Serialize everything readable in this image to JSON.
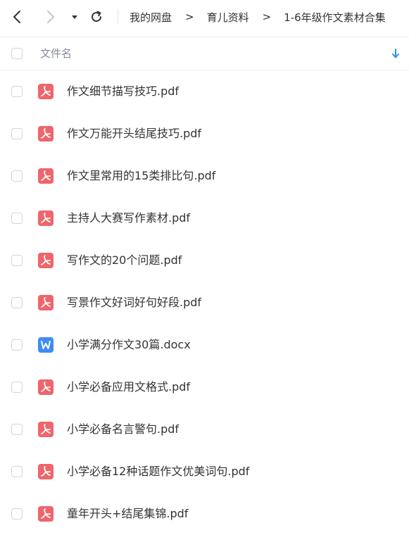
{
  "nav": {
    "back_icon": "chevron-left-icon",
    "forward_icon": "chevron-right-icon",
    "dropdown_icon": "triangle-down-icon",
    "refresh_icon": "refresh-icon"
  },
  "breadcrumb": {
    "items": [
      "我的网盘",
      "育儿资料",
      "1-6年级作文素材合集"
    ],
    "separator": ">"
  },
  "list_header": {
    "name_label": "文件名",
    "sort_icon": "arrow-down-icon"
  },
  "colors": {
    "pdf_icon": "#f0656b",
    "docx_icon": "#3f8cf5",
    "sort_icon": "#2e90f0",
    "text": "#333333",
    "header_text": "#878c9c"
  },
  "files": [
    {
      "name": "作文细节描写技巧.pdf",
      "type": "pdf",
      "icon": "pdf-icon"
    },
    {
      "name": "作文万能开头结尾技巧.pdf",
      "type": "pdf",
      "icon": "pdf-icon"
    },
    {
      "name": "作文里常用的15类排比句.pdf",
      "type": "pdf",
      "icon": "pdf-icon"
    },
    {
      "name": "主持人大赛写作素材.pdf",
      "type": "pdf",
      "icon": "pdf-icon"
    },
    {
      "name": "写作文的20个问题.pdf",
      "type": "pdf",
      "icon": "pdf-icon"
    },
    {
      "name": "写景作文好词好句好段.pdf",
      "type": "pdf",
      "icon": "pdf-icon"
    },
    {
      "name": "小学满分作文30篇.docx",
      "type": "docx",
      "icon": "word-icon"
    },
    {
      "name": "小学必备应用文格式.pdf",
      "type": "pdf",
      "icon": "pdf-icon"
    },
    {
      "name": "小学必备名言警句.pdf",
      "type": "pdf",
      "icon": "pdf-icon"
    },
    {
      "name": "小学必备12种话题作文优美词句.pdf",
      "type": "pdf",
      "icon": "pdf-icon"
    },
    {
      "name": "童年开头+结尾集锦.pdf",
      "type": "pdf",
      "icon": "pdf-icon"
    }
  ]
}
